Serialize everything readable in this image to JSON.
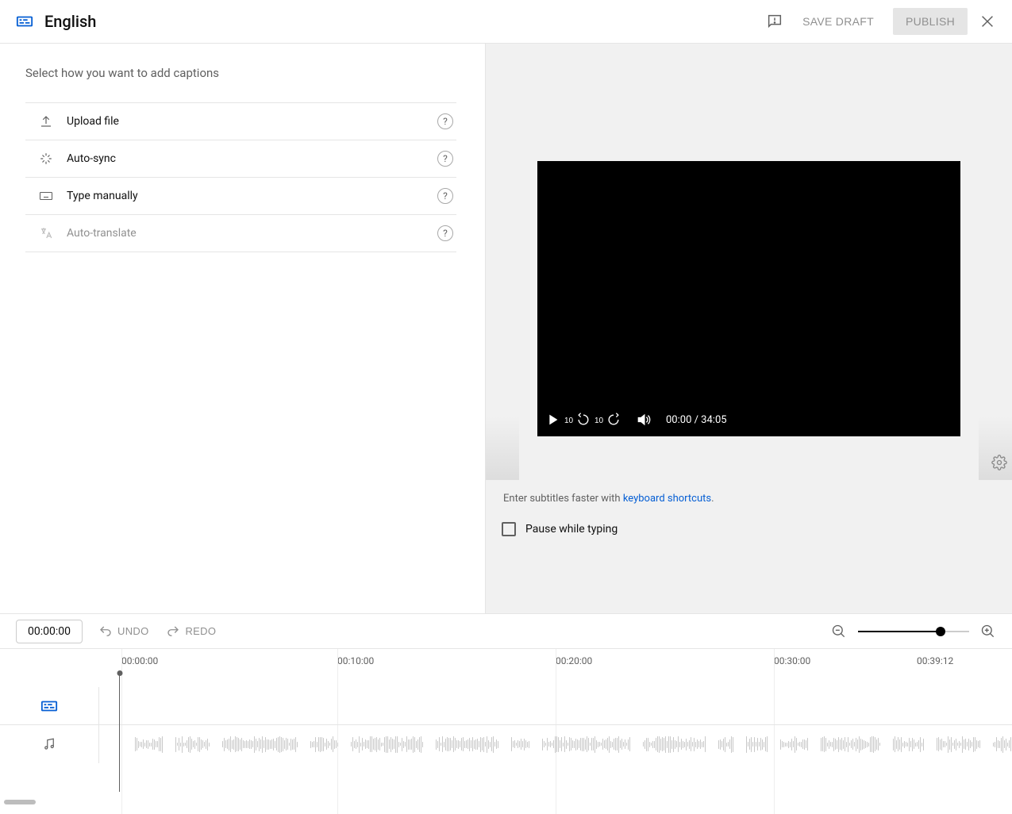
{
  "header": {
    "title": "English",
    "save_draft": "SAVE DRAFT",
    "publish": "PUBLISH"
  },
  "left": {
    "instructions": "Select how you want to add captions",
    "options": [
      {
        "label": "Upload file",
        "icon": "upload",
        "disabled": false
      },
      {
        "label": "Auto-sync",
        "icon": "sparkle",
        "disabled": false
      },
      {
        "label": "Type manually",
        "icon": "keyboard",
        "disabled": false
      },
      {
        "label": "Auto-translate",
        "icon": "translate",
        "disabled": true
      }
    ]
  },
  "player": {
    "time_display": "00:00 / 34:05",
    "hint_prefix": "Enter subtitles faster with ",
    "hint_link": "keyboard shortcuts",
    "hint_suffix": ".",
    "pause_label": "Pause while typing"
  },
  "toolbar": {
    "timecode": "00:00:00",
    "undo": "UNDO",
    "redo": "REDO"
  },
  "timeline": {
    "labels": [
      {
        "text": "00:00:00",
        "pos": 28
      },
      {
        "text": "00:10:00",
        "pos": 300
      },
      {
        "text": "00:20:00",
        "pos": 575
      },
      {
        "text": "00:30:00",
        "pos": 850
      },
      {
        "text": "00:39:12",
        "pos": 1030
      }
    ],
    "ticks": [
      28,
      300,
      575,
      850
    ]
  }
}
